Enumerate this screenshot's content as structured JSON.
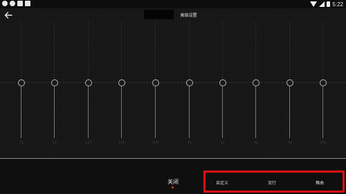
{
  "status_bar": {
    "left_icons": [
      "notification-icon",
      "notification-icon",
      "image-icon",
      "android-icon"
    ],
    "right_icons": [
      "wifi-icon",
      "signal-icon",
      "battery-icon"
    ],
    "time": "5:22"
  },
  "header": {
    "back_icon": "arrow-left-icon",
    "tabs": [
      {
        "label": "",
        "active": true
      },
      {
        "label": "高级设置",
        "active": false
      }
    ]
  },
  "equalizer": {
    "bands": [
      {
        "label": "31",
        "level": 0
      },
      {
        "label": "62",
        "level": 0
      },
      {
        "label": "125",
        "level": 0
      },
      {
        "label": "250",
        "level": 0
      },
      {
        "label": "500",
        "level": 0
      },
      {
        "label": "1k",
        "level": 0
      },
      {
        "label": "2k",
        "level": 0
      },
      {
        "label": "4k",
        "level": 0
      },
      {
        "label": "8k",
        "level": 0
      },
      {
        "label": "16k",
        "level": 0
      }
    ]
  },
  "presets": {
    "off_label": "关闭",
    "items": [
      "自定义",
      "流行",
      "舞曲"
    ],
    "selected": "关闭"
  },
  "colors": {
    "accent_dot": "#e23a2d",
    "highlight_box": "#e20f12"
  }
}
